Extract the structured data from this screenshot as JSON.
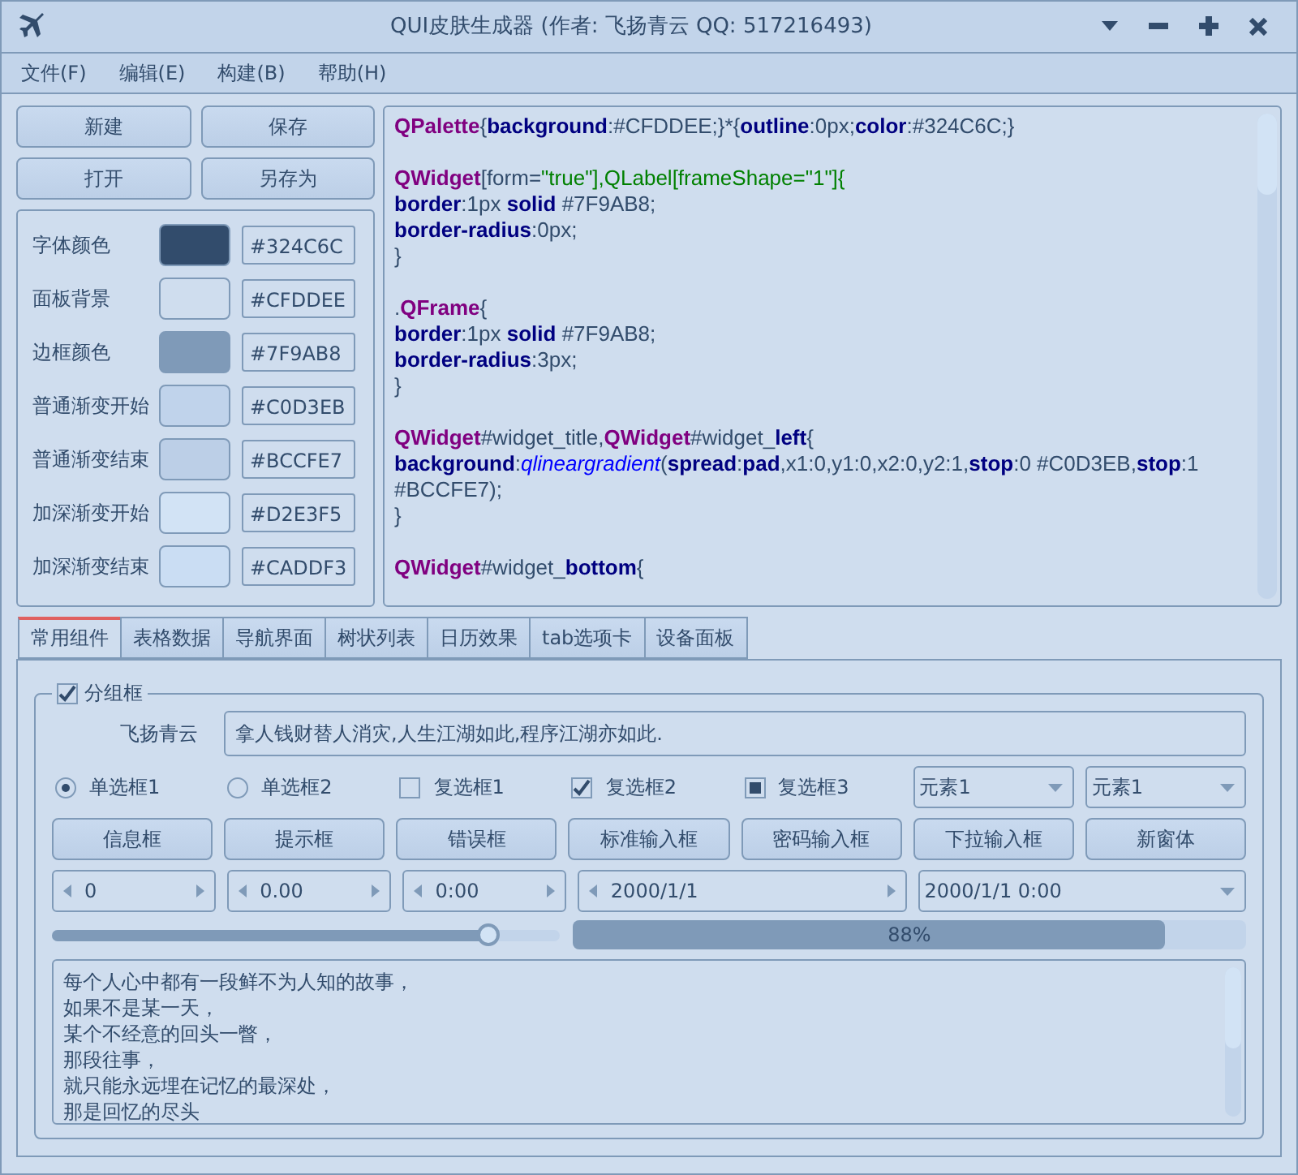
{
  "window": {
    "title": "QUI皮肤生成器 (作者: 飞扬青云  QQ: 517216493)"
  },
  "menu": [
    "文件(F)",
    "编辑(E)",
    "构建(B)",
    "帮助(H)"
  ],
  "file_buttons": [
    "新建",
    "保存",
    "打开",
    "另存为"
  ],
  "colors": [
    {
      "label": "字体颜色",
      "color": "#324c6c",
      "hex": "#324C6C"
    },
    {
      "label": "面板背景",
      "color": "#cfddee",
      "hex": "#CFDDEE"
    },
    {
      "label": "边框颜色",
      "color": "#7f9ab8",
      "hex": "#7F9AB8"
    },
    {
      "label": "普通渐变开始",
      "color": "#c0d3eb",
      "hex": "#C0D3EB"
    },
    {
      "label": "普通渐变结束",
      "color": "#bccfe7",
      "hex": "#BCCFE7"
    },
    {
      "label": "加深渐变开始",
      "color": "#d2e3f5",
      "hex": "#D2E3F5"
    },
    {
      "label": "加深渐变结束",
      "color": "#caddf3",
      "hex": "#CADDF3"
    }
  ],
  "code_blocks": [
    [
      [
        {
          "kind": "sel",
          "text": "QPalette"
        },
        {
          "kind": "p",
          "text": "{"
        },
        {
          "kind": "prop",
          "text": "background"
        },
        {
          "kind": "p",
          "text": ":#CFDDEE;}*{"
        },
        {
          "kind": "prop",
          "text": "outline"
        },
        {
          "kind": "p",
          "text": ":0px;"
        },
        {
          "kind": "prop",
          "text": "color"
        },
        {
          "kind": "p",
          "text": ":#324C6C;}"
        }
      ]
    ],
    [
      [
        {
          "kind": "sel",
          "text": "QWidget"
        },
        {
          "kind": "p",
          "text": "[form="
        },
        {
          "kind": "str",
          "text": "\"true\"],QLabel[frameShape=\"1\"]{"
        }
      ],
      [
        {
          "kind": "prop",
          "text": "border"
        },
        {
          "kind": "p",
          "text": ":1px "
        },
        {
          "kind": "prop",
          "text": "solid"
        },
        {
          "kind": "p",
          "text": " #7F9AB8;"
        }
      ],
      [
        {
          "kind": "prop",
          "text": "border-radius"
        },
        {
          "kind": "p",
          "text": ":0px;"
        }
      ],
      [
        {
          "kind": "p",
          "text": "}"
        }
      ]
    ],
    [
      [
        {
          "kind": "p",
          "text": "."
        },
        {
          "kind": "sel",
          "text": "QFrame"
        },
        {
          "kind": "p",
          "text": "{"
        }
      ],
      [
        {
          "kind": "prop",
          "text": "border"
        },
        {
          "kind": "p",
          "text": ":1px "
        },
        {
          "kind": "prop",
          "text": "solid"
        },
        {
          "kind": "p",
          "text": " #7F9AB8;"
        }
      ],
      [
        {
          "kind": "prop",
          "text": "border-radius"
        },
        {
          "kind": "p",
          "text": ":3px;"
        }
      ],
      [
        {
          "kind": "p",
          "text": "}"
        }
      ]
    ],
    [
      [
        {
          "kind": "sel",
          "text": "QWidget"
        },
        {
          "kind": "p",
          "text": "#widget_title,"
        },
        {
          "kind": "sel",
          "text": "QWidget"
        },
        {
          "kind": "p",
          "text": "#widget_"
        },
        {
          "kind": "prop",
          "text": "left"
        },
        {
          "kind": "p",
          "text": "{"
        }
      ],
      [
        {
          "kind": "prop",
          "text": "background"
        },
        {
          "kind": "p",
          "text": ":"
        },
        {
          "kind": "func",
          "text": "qlineargradient"
        },
        {
          "kind": "p",
          "text": "("
        },
        {
          "kind": "prop",
          "text": "spread"
        },
        {
          "kind": "p",
          "text": ":"
        },
        {
          "kind": "prop",
          "text": "pad"
        },
        {
          "kind": "p",
          "text": ",x1:0,y1:0,x2:0,y2:1,"
        },
        {
          "kind": "prop",
          "text": "stop"
        },
        {
          "kind": "p",
          "text": ":0 #C0D3EB,"
        },
        {
          "kind": "prop",
          "text": "stop"
        },
        {
          "kind": "p",
          "text": ":1 #BCCFE7);"
        }
      ],
      [
        {
          "kind": "p",
          "text": "}"
        }
      ]
    ],
    [
      [
        {
          "kind": "sel",
          "text": "QWidget"
        },
        {
          "kind": "p",
          "text": "#widget_"
        },
        {
          "kind": "prop",
          "text": "bottom"
        },
        {
          "kind": "p",
          "text": "{"
        }
      ]
    ]
  ],
  "tabs": [
    {
      "label": "常用组件",
      "selected": true
    },
    {
      "label": "表格数据",
      "selected": false
    },
    {
      "label": "导航界面",
      "selected": false
    },
    {
      "label": "树状列表",
      "selected": false
    },
    {
      "label": "日历效果",
      "selected": false
    },
    {
      "label": "tab选项卡",
      "selected": false
    },
    {
      "label": "设备面板",
      "selected": false
    }
  ],
  "group": {
    "title": "分组框",
    "checked": true,
    "label": "飞扬青云",
    "text_value": "拿人钱财替人消灾,人生江湖如此,程序江湖亦如此."
  },
  "options": [
    {
      "kind": "radio",
      "label": "单选框1",
      "selected": true
    },
    {
      "kind": "radio",
      "label": "单选框2",
      "selected": false
    },
    {
      "kind": "checkbox",
      "label": "复选框1",
      "checked": false
    },
    {
      "kind": "checkbox",
      "label": "复选框2",
      "checked": true
    },
    {
      "kind": "tristate",
      "label": "复选框3",
      "checked": true
    }
  ],
  "combos": [
    "元素1",
    "元素1"
  ],
  "buttons": [
    "信息框",
    "提示框",
    "错误框",
    "标准输入框",
    "密码输入框",
    "下拉输入框",
    "新窗体"
  ],
  "spinners": [
    {
      "kind": "spin",
      "value": "0"
    },
    {
      "kind": "spin",
      "value": "0.00"
    },
    {
      "kind": "spin",
      "value": "0:00"
    },
    {
      "kind": "spin",
      "value": "2000/1/1"
    },
    {
      "kind": "combo",
      "value": "2000/1/1 0:00"
    }
  ],
  "slider": {
    "level": 0.86
  },
  "progress": {
    "level": 0.88,
    "text": "88%"
  },
  "text_lines": [
    "每个人心中都有一段鲜不为人知的故事，",
    "如果不是某一天，",
    "某个不经意的回头一瞥，",
    "那段往事，",
    "就只能永远埋在记忆的最深处，",
    "那是回忆的尽头"
  ]
}
